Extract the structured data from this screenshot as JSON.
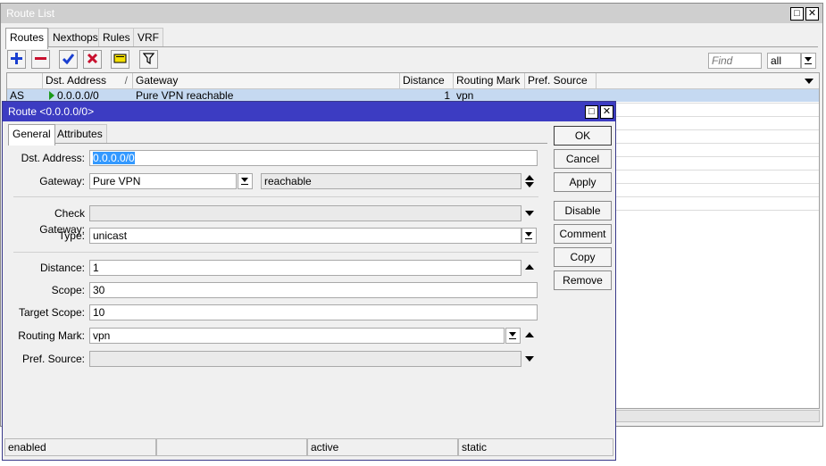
{
  "route_list": {
    "title": "Route List",
    "tabs": [
      "Routes",
      "Nexthops",
      "Rules",
      "VRF"
    ],
    "find_placeholder": "Find",
    "filter_value": "all",
    "columns": [
      "",
      "Dst. Address",
      "Gateway",
      "Distance",
      "Routing Mark",
      "Pref. Source"
    ],
    "rows": [
      {
        "flags": "AS",
        "dst": "0.0.0.0/0",
        "gateway": "Pure VPN reachable",
        "distance": "1",
        "routing_mark": "vpn",
        "pref_source": ""
      }
    ]
  },
  "dialog": {
    "title": "Route <0.0.0.0/0>",
    "tabs": [
      "General",
      "Attributes"
    ],
    "fields": {
      "dst_address": {
        "label": "Dst. Address:",
        "value": "0.0.0.0/0"
      },
      "gateway": {
        "label": "Gateway:",
        "value": "Pure VPN",
        "status": "reachable"
      },
      "check_gateway": {
        "label": "Check Gateway:",
        "value": ""
      },
      "type": {
        "label": "Type:",
        "value": "unicast"
      },
      "distance": {
        "label": "Distance:",
        "value": "1"
      },
      "scope": {
        "label": "Scope:",
        "value": "30"
      },
      "target_scope": {
        "label": "Target Scope:",
        "value": "10"
      },
      "routing_mark": {
        "label": "Routing Mark:",
        "value": "vpn"
      },
      "pref_source": {
        "label": "Pref. Source:",
        "value": ""
      }
    },
    "buttons": {
      "ok": "OK",
      "cancel": "Cancel",
      "apply": "Apply",
      "disable": "Disable",
      "comment": "Comment",
      "copy": "Copy",
      "remove": "Remove"
    },
    "status": [
      "enabled",
      "",
      "active",
      "static"
    ]
  },
  "colors": {
    "dialog_title": "#3c3cc2",
    "selected_row": "#c5d9f1",
    "add": "#1a3fd0",
    "remove": "#c8102e",
    "enable": "#1a3fd0",
    "disable_x": "#c8102e"
  }
}
